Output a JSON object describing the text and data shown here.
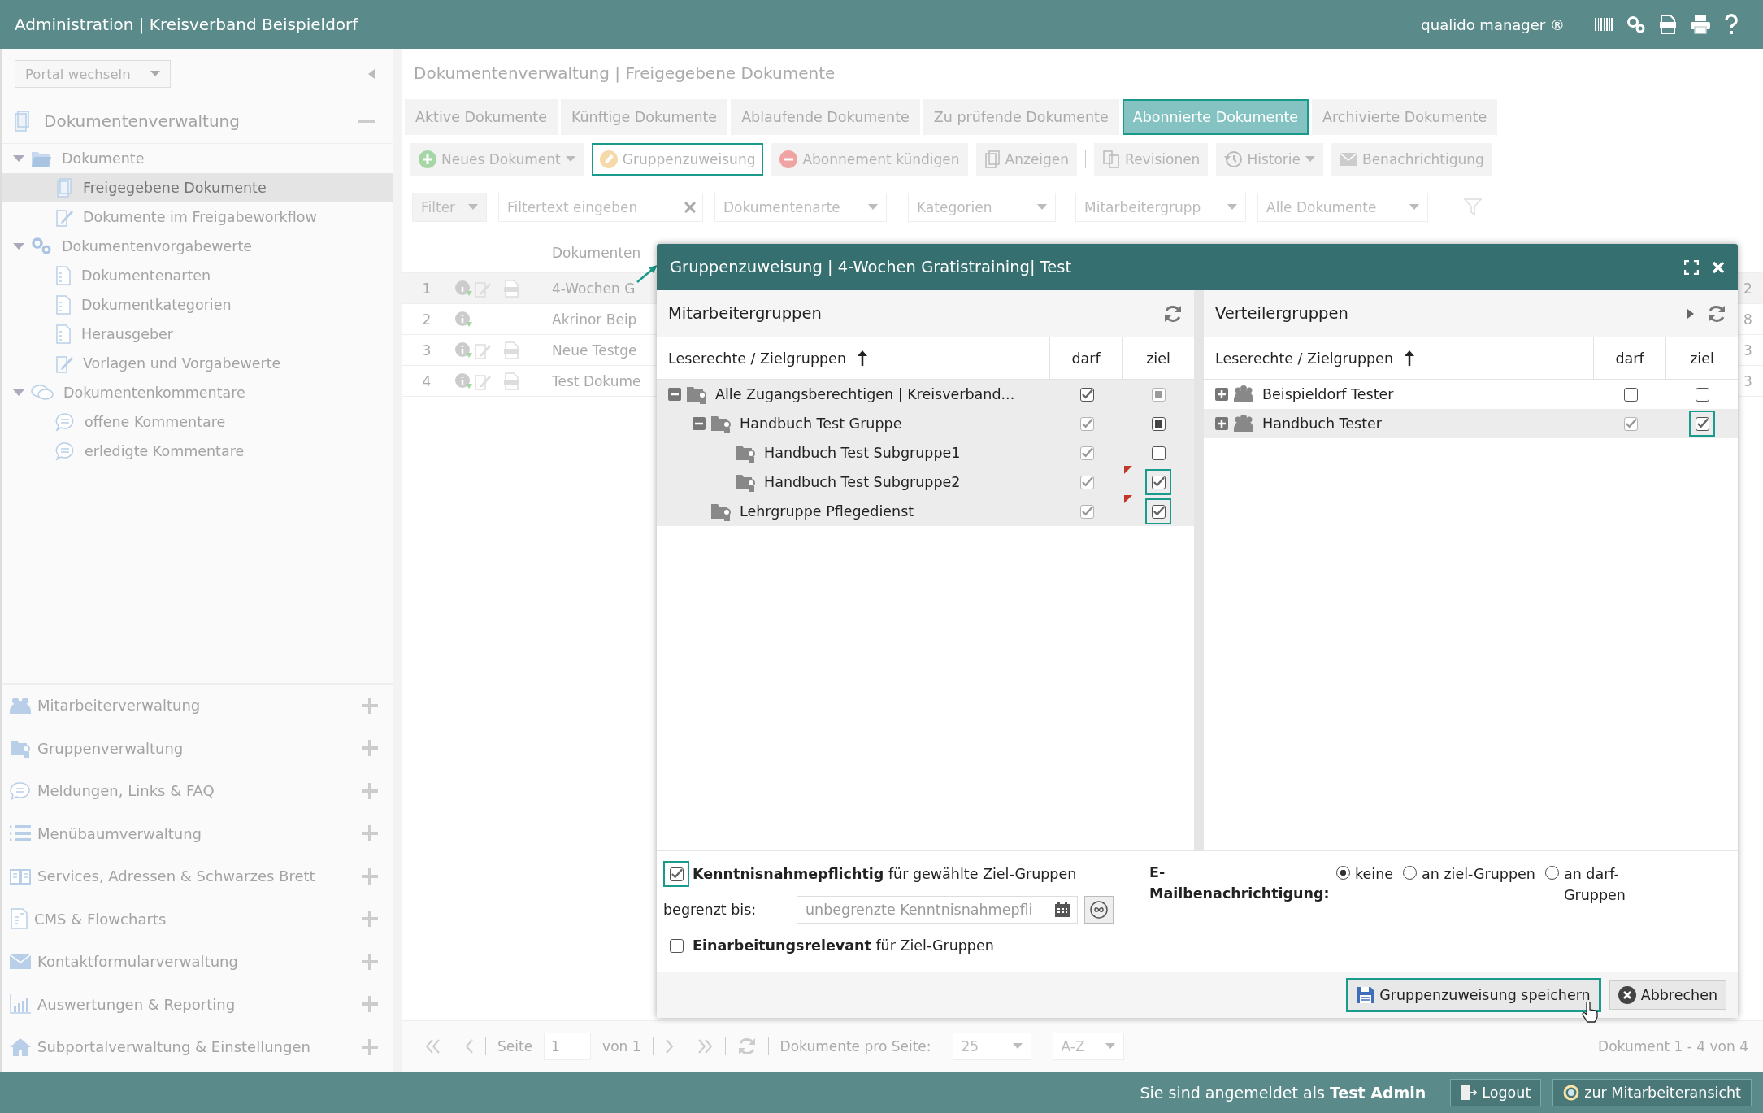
{
  "app_bar": {
    "title": "Administration | Kreisverband Beispieldorf",
    "brand": "qualido manager ®"
  },
  "sidebar": {
    "portal_select": "Portal wechseln",
    "section": {
      "title": "Dokumentenverwaltung",
      "expanded": true
    },
    "tree": [
      {
        "label": "Dokumente",
        "kind": "folder",
        "selected": false,
        "expanded": true,
        "children": [
          {
            "label": "Freigegebene Dokumente",
            "kind": "docs",
            "selected": true
          },
          {
            "label": "Dokumente im Freigabeworkflow",
            "kind": "edit",
            "selected": false
          }
        ]
      },
      {
        "label": "Dokumentenvorgabewerte",
        "kind": "gears",
        "selected": false,
        "expanded": true,
        "children": [
          {
            "label": "Dokumentenarten",
            "kind": "page",
            "selected": false
          },
          {
            "label": "Dokumentkategorien",
            "kind": "page",
            "selected": false
          },
          {
            "label": "Herausgeber",
            "kind": "page",
            "selected": false
          },
          {
            "label": "Vorlagen und Vorgabewerte",
            "kind": "edit",
            "selected": false
          }
        ]
      },
      {
        "label": "Dokumentenkommentare",
        "kind": "comments",
        "selected": false,
        "expanded": true,
        "children": [
          {
            "label": "offene Kommentare",
            "kind": "comment",
            "selected": false
          },
          {
            "label": "erledigte Kommentare",
            "kind": "comment",
            "selected": false
          }
        ]
      }
    ],
    "modules": [
      {
        "label": "Mitarbeiterverwaltung",
        "kind": "people"
      },
      {
        "label": "Gruppenverwaltung",
        "kind": "groupfolder"
      },
      {
        "label": "Meldungen, Links & FAQ",
        "kind": "comment"
      },
      {
        "label": "Menübaumverwaltung",
        "kind": "list"
      },
      {
        "label": "Services, Adressen & Schwarzes Brett",
        "kind": "book"
      },
      {
        "label": "CMS & Flowcharts",
        "kind": "page"
      },
      {
        "label": "Kontaktformularverwaltung",
        "kind": "mail"
      },
      {
        "label": "Auswertungen & Reporting",
        "kind": "chart"
      },
      {
        "label": "Subportalverwaltung & Einstellungen",
        "kind": "home"
      }
    ]
  },
  "breadcrumb": "Dokumentenverwaltung | Freigegebene Dokumente",
  "tabs": [
    {
      "label": "Aktive Dokumente",
      "selected": false,
      "highlighted": false
    },
    {
      "label": "Künftige Dokumente",
      "selected": false,
      "highlighted": false
    },
    {
      "label": "Ablaufende Dokumente",
      "selected": false,
      "highlighted": false
    },
    {
      "label": "Zu prüfende Dokumente",
      "selected": false,
      "highlighted": false
    },
    {
      "label": "Abonnierte Dokumente",
      "selected": true,
      "highlighted": true
    },
    {
      "label": "Archivierte Dokumente",
      "selected": false,
      "highlighted": false
    }
  ],
  "toolbar_groups": [
    {
      "buttons": [
        {
          "label": "Neues Dokument",
          "kind": "add",
          "dropdown": true,
          "highlighted": false
        },
        {
          "label": "Gruppenzuweisung",
          "kind": "assign",
          "dropdown": false,
          "highlighted": true
        },
        {
          "label": "Abonnement kündigen",
          "kind": "remove",
          "dropdown": false,
          "highlighted": false
        },
        {
          "label": "Anzeigen",
          "kind": "view",
          "dropdown": false,
          "highlighted": false
        }
      ]
    },
    {
      "buttons": [
        {
          "label": "Revisionen",
          "kind": "revisions",
          "dropdown": false,
          "highlighted": false
        },
        {
          "label": "Historie",
          "kind": "history",
          "dropdown": true,
          "highlighted": false
        },
        {
          "label": "Benachrichtigung",
          "kind": "mail",
          "dropdown": false,
          "highlighted": false
        }
      ]
    }
  ],
  "filters": {
    "filter_button": "Filter",
    "search": {
      "placeholder": "Filtertext eingeben"
    },
    "dropdowns": [
      "Dokumentenarte",
      "Kategorien",
      "Mitarbeitergrupp",
      "Alle Dokumente"
    ]
  },
  "table": {
    "columns": [
      "Dokumenten"
    ],
    "rows": [
      {
        "number": "1",
        "title": "4-Wochen G",
        "column_last": "2",
        "selected": true,
        "editable": true,
        "file": true
      },
      {
        "number": "2",
        "title": "Akrinor Beip",
        "column_last": "8",
        "selected": false,
        "editable": false,
        "file": false
      },
      {
        "number": "3",
        "title": "Neue Testge",
        "column_last": "3",
        "selected": false,
        "editable": true,
        "file": true
      },
      {
        "number": "4",
        "title": "Test Dokume",
        "column_last": "3",
        "selected": false,
        "editable": true,
        "file": true
      }
    ]
  },
  "pager": {
    "page_label": "Seite",
    "page": "1",
    "of": "von 1",
    "per_page_label": "Dokumente pro Seite:",
    "per_page": "25",
    "sort": "A-Z",
    "summary": "Dokument 1 - 4 von 4"
  },
  "status_bar": {
    "login_text": "Sie sind angemeldet als **Test Admin**",
    "buttons": [
      {
        "label": "Logout",
        "kind": "logout"
      },
      {
        "label": "zur Mitarbeiteransicht",
        "kind": "switch"
      }
    ]
  },
  "dialog": {
    "title": "Gruppenzuweisung | 4-Wochen Gratistraining| Test",
    "panels": [
      {
        "title": "Mitarbeitergruppen",
        "columns": [
          "Leserechte / Zielgruppen",
          "darf",
          "ziel"
        ],
        "rows": [
          {
            "label": "Alle Zugangsberechtigen | Kreisverband...",
            "kind": "folder",
            "expanded": true,
            "selected": true,
            "changed": false,
            "darf": {
              "kind": "box",
              "checked": true
            },
            "ziel": {
              "kind": "greypartial",
              "checked": false
            },
            "children": [
              {
                "label": "Handbuch Test Gruppe",
                "kind": "folder",
                "expanded": true,
                "selected": true,
                "changed": false,
                "darf": {
                  "kind": "greybox",
                  "checked": true
                },
                "ziel": {
                  "kind": "partial",
                  "checked": false
                },
                "children": [
                  {
                    "label": "Handbuch Test Subgruppe1",
                    "kind": "folder",
                    "selected": true,
                    "changed": false,
                    "darf": {
                      "kind": "greybox",
                      "checked": true
                    },
                    "ziel": {
                      "kind": "box",
                      "checked": false
                    }
                  },
                  {
                    "label": "Handbuch Test Subgruppe2",
                    "kind": "folder",
                    "selected": true,
                    "changed": true,
                    "darf": {
                      "kind": "greybox",
                      "checked": true
                    },
                    "ziel": {
                      "kind": "box",
                      "checked": true,
                      "highlighted": true
                    }
                  }
                ]
              },
              {
                "label": "Lehrgruppe Pflegedienst",
                "kind": "folder",
                "selected": true,
                "changed": true,
                "darf": {
                  "kind": "greybox",
                  "checked": true
                },
                "ziel": {
                  "kind": "box",
                  "checked": true,
                  "highlighted": true
                }
              }
            ]
          }
        ]
      },
      {
        "title": "Verteilergruppen",
        "columns": [
          "Leserechte / Zielgruppen",
          "darf",
          "ziel"
        ],
        "rows": [
          {
            "label": "Beispieldorf Tester",
            "kind": "team",
            "expanded": false,
            "selected": false,
            "changed": false,
            "darf": {
              "kind": "box",
              "checked": false
            },
            "ziel": {
              "kind": "box",
              "checked": false
            }
          },
          {
            "label": "Handbuch Tester",
            "kind": "team",
            "expanded": false,
            "selected": true,
            "changed": false,
            "darf": {
              "kind": "greybox",
              "checked": true
            },
            "ziel": {
              "kind": "box",
              "checked": true,
              "highlighted": true
            }
          }
        ]
      }
    ],
    "acknowledge": {
      "text": "**Kenntnisnahmepflichtig** für gewählte Ziel-Gruppen",
      "checked": true,
      "highlighted": true
    },
    "limit": {
      "label": "begrenzt bis:",
      "placeholder": "unbegrenzte Kenntnisnahmepfli"
    },
    "training": {
      "text": "**Einarbeitungsrelevant** für Ziel-Gruppen",
      "checked": false
    },
    "email": {
      "label": "E-Mailbenachrichtigung:",
      "options": [
        {
          "label": "keine",
          "selected": true
        },
        {
          "label": "an ziel-Gruppen",
          "selected": false
        },
        {
          "label": "an darf-Gruppen",
          "selected": false
        }
      ]
    },
    "buttons": [
      {
        "label": "Gruppenzuweisung speichern",
        "kind": "save",
        "highlighted": true
      },
      {
        "label": "Abbrechen",
        "kind": "cancel",
        "highlighted": false
      }
    ]
  }
}
